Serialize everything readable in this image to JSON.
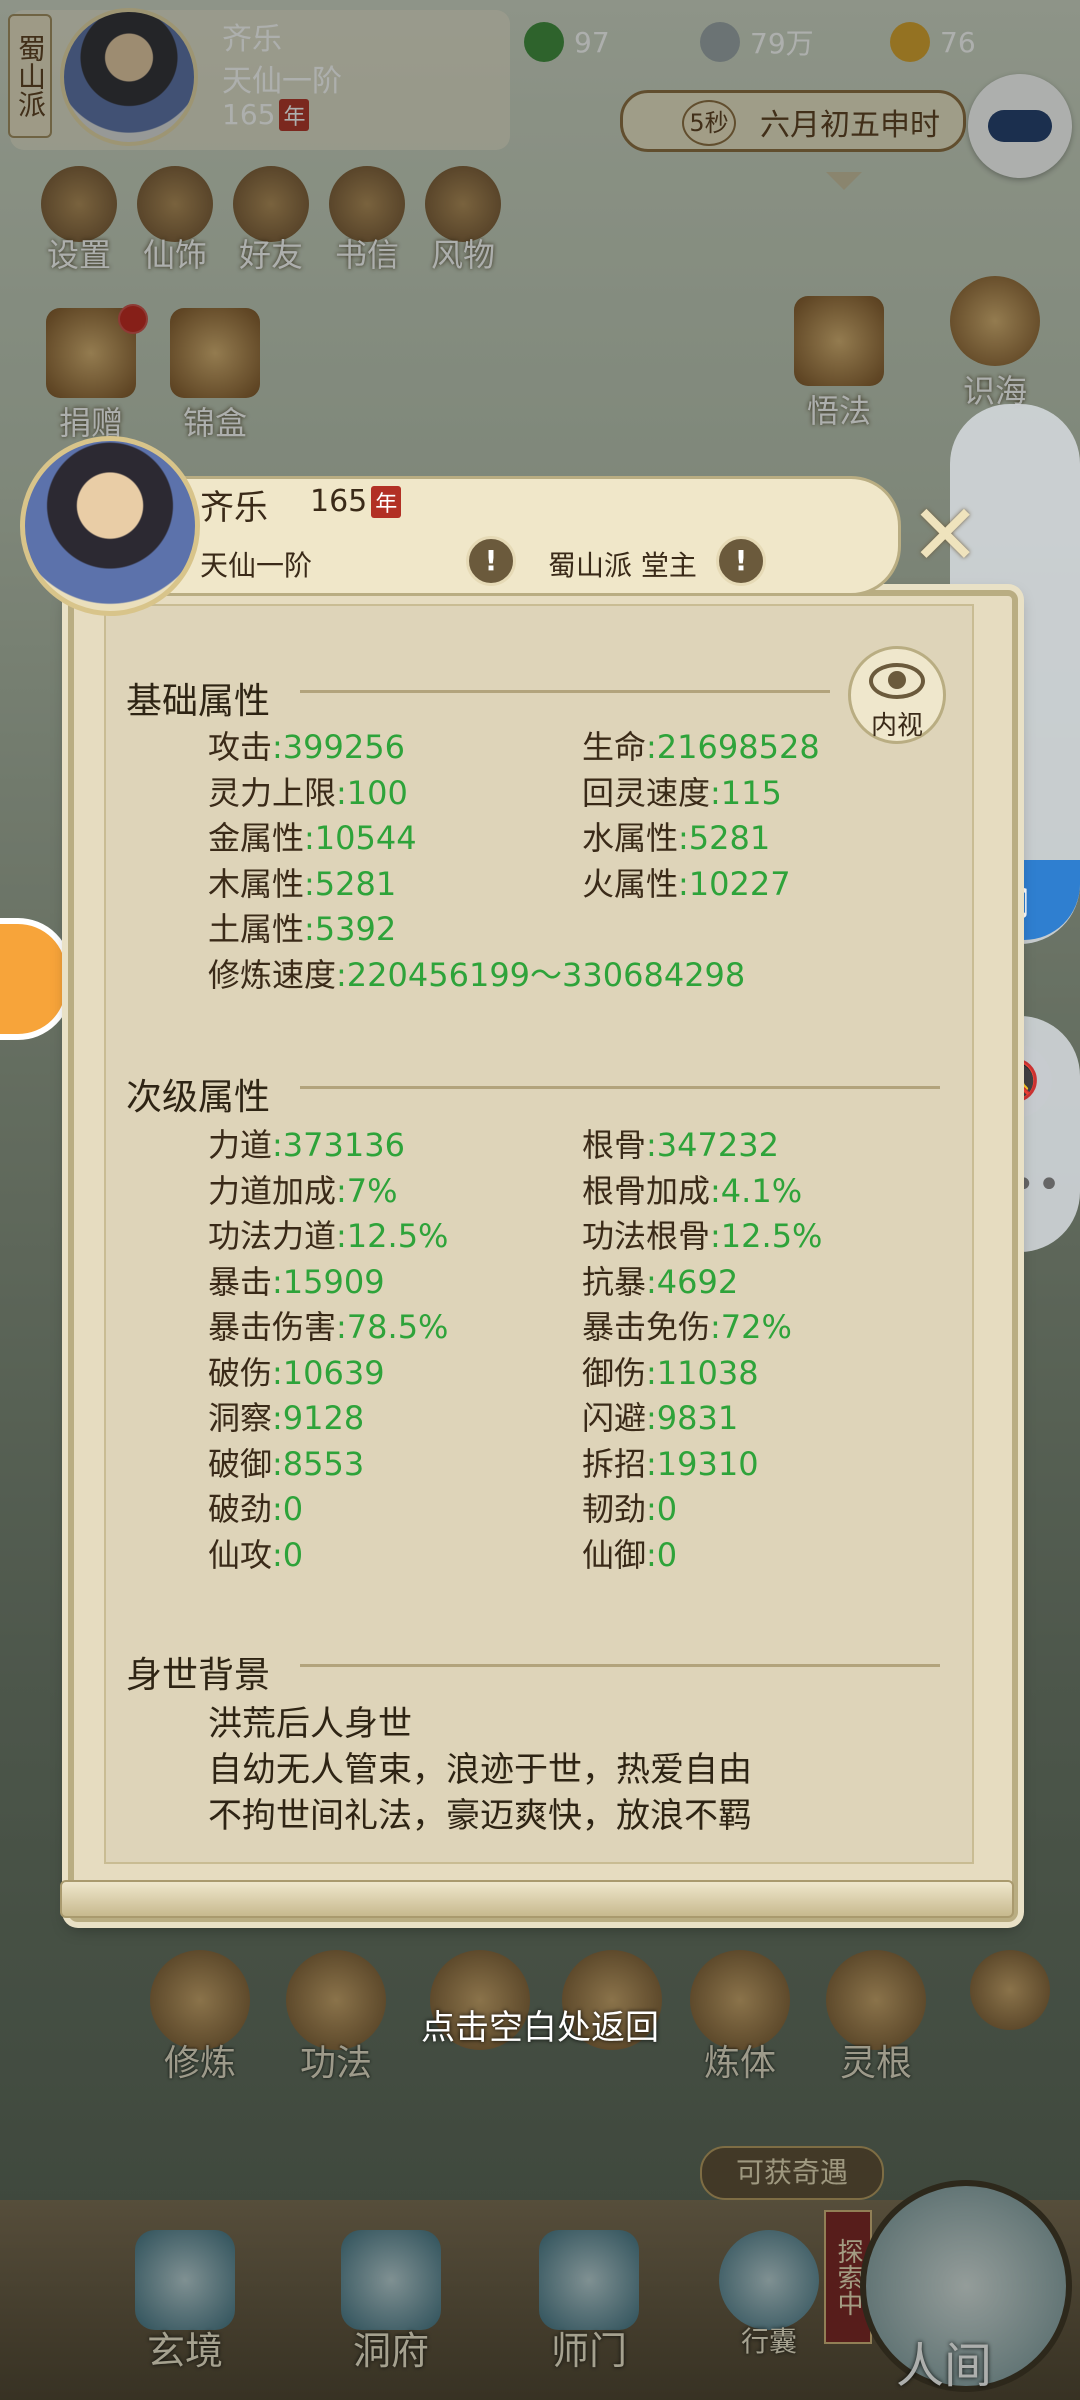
{
  "top": {
    "sect": "蜀山派",
    "name": "齐乐",
    "realm": "天仙一阶",
    "age": "165",
    "age_badge": "年",
    "jade": "97",
    "coins": "79万",
    "strength": "76",
    "time_seconds": "5秒",
    "time_text": "六月初五申时",
    "menu": [
      "设置",
      "仙饰",
      "好友",
      "书信",
      "风物"
    ],
    "left_buttons": [
      "捐赠",
      "锦盒"
    ],
    "right_buttons": [
      "悟法",
      "识海"
    ]
  },
  "dialog": {
    "name": "齐乐",
    "age": "165",
    "age_badge": "年",
    "realm": "天仙一阶",
    "sect_position": "蜀山派 堂主",
    "warn_glyph": "!",
    "close_glyph": "✕",
    "neishi_label": "内视",
    "basic": {
      "title": "基础属性",
      "rows": [
        [
          {
            "label": "攻击",
            "value": "399256"
          },
          {
            "label": "生命",
            "value": "21698528"
          }
        ],
        [
          {
            "label": "灵力上限",
            "value": "100"
          },
          {
            "label": "回灵速度",
            "value": "115"
          }
        ],
        [
          {
            "label": "金属性",
            "value": "10544"
          },
          {
            "label": "水属性",
            "value": "5281"
          }
        ],
        [
          {
            "label": "木属性",
            "value": "5281"
          },
          {
            "label": "火属性",
            "value": "10227"
          }
        ],
        [
          {
            "label": "土属性",
            "value": "5392"
          },
          null
        ],
        [
          {
            "label": "修炼速度",
            "value": "220456199～330684298"
          },
          null
        ]
      ]
    },
    "secondary": {
      "title": "次级属性",
      "rows": [
        [
          {
            "label": "力道",
            "value": "373136"
          },
          {
            "label": "根骨",
            "value": "347232"
          }
        ],
        [
          {
            "label": "力道加成",
            "value": "7%"
          },
          {
            "label": "根骨加成",
            "value": "4.1%"
          }
        ],
        [
          {
            "label": "功法力道",
            "value": "12.5%"
          },
          {
            "label": "功法根骨",
            "value": "12.5%"
          }
        ],
        [
          {
            "label": "暴击",
            "value": "15909"
          },
          {
            "label": "抗暴",
            "value": "4692"
          }
        ],
        [
          {
            "label": "暴击伤害",
            "value": "78.5%"
          },
          {
            "label": "暴击免伤",
            "value": "72%"
          }
        ],
        [
          {
            "label": "破伤",
            "value": "10639"
          },
          {
            "label": "御伤",
            "value": "11038"
          }
        ],
        [
          {
            "label": "洞察",
            "value": "9128"
          },
          {
            "label": "闪避",
            "value": "9831"
          }
        ],
        [
          {
            "label": "破御",
            "value": "8553"
          },
          {
            "label": "拆招",
            "value": "19310"
          }
        ],
        [
          {
            "label": "破劲",
            "value": "0"
          },
          {
            "label": "韧劲",
            "value": "0"
          }
        ],
        [
          {
            "label": "仙攻",
            "value": "0"
          },
          {
            "label": "仙御",
            "value": "0"
          }
        ]
      ]
    },
    "background": {
      "title": "身世背景",
      "lines": [
        "洪荒后人身世",
        "自幼无人管束，浪迹于世，热爱自由",
        "不拘世间礼法，豪迈爽快，放浪不羁"
      ]
    }
  },
  "bottom": {
    "return_hint": "点击空白处返回",
    "actions": [
      "修炼",
      "功法",
      "",
      "",
      "炼体",
      "灵根"
    ],
    "qiyu": "可获奇遇",
    "explore": "探索中",
    "nav": [
      "玄境",
      "洞府",
      "师门",
      "行囊"
    ],
    "world": "人间"
  },
  "colors": {
    "value_green": "#2ea33a",
    "text_brown": "#3a2a18",
    "parchment": "#ded4b9",
    "badge_red": "#b23024",
    "float_blue": "#2f7fd0"
  },
  "icons": [
    "jade-icon",
    "coin-icon",
    "strength-icon",
    "eye-icon",
    "music-note-icon",
    "mute-bell-icon",
    "more-icon",
    "gamepad-icon",
    "close-icon",
    "warning-icon"
  ]
}
